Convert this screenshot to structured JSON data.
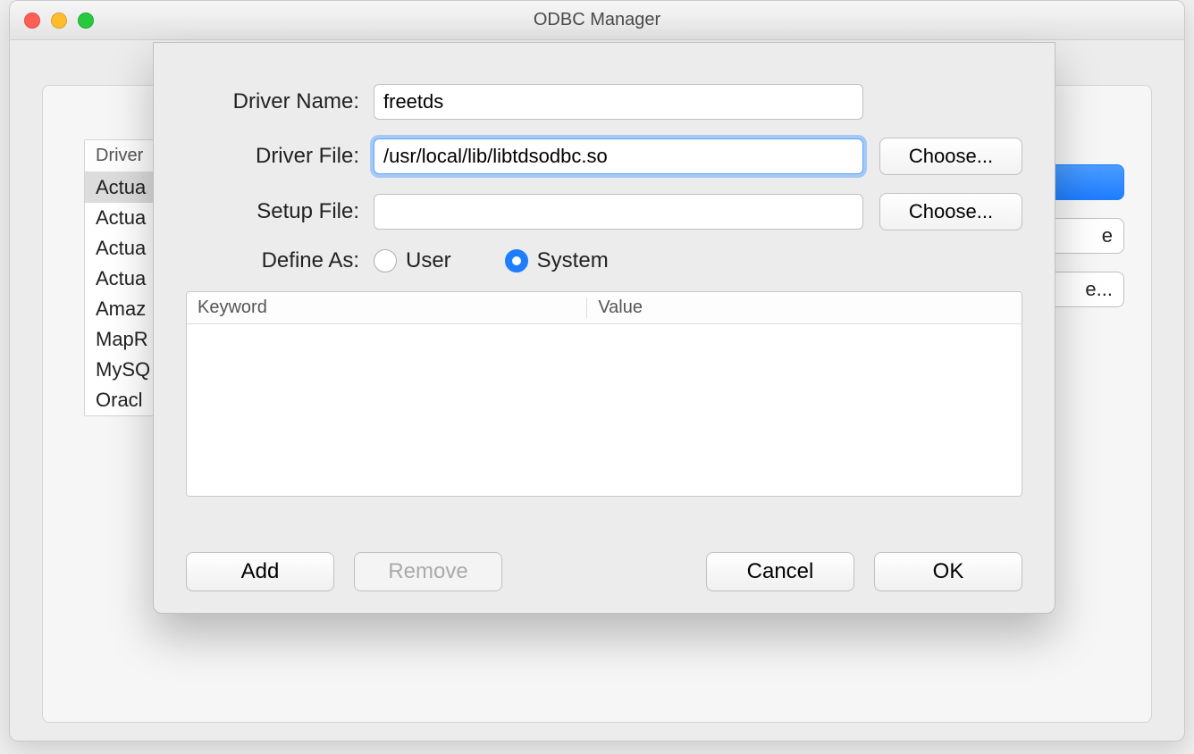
{
  "window": {
    "title": "ODBC Manager"
  },
  "background": {
    "list_header": "Driver",
    "list_items": [
      "Actua",
      "Actua",
      "Actua",
      "Actua",
      "Amaz",
      "MapR",
      "MySQ",
      "Oracl"
    ],
    "side_buttons": [
      "",
      "e",
      "e..."
    ]
  },
  "dialog": {
    "labels": {
      "driver_name": "Driver Name:",
      "driver_file": "Driver File:",
      "setup_file": "Setup File:",
      "define_as": "Define As:"
    },
    "fields": {
      "driver_name": "freetds",
      "driver_file": "/usr/local/lib/libtdsodbc.so",
      "setup_file": ""
    },
    "choose_label": "Choose...",
    "define_options": {
      "user": "User",
      "system": "System"
    },
    "define_selected": "system",
    "kv_headers": {
      "keyword": "Keyword",
      "value": "Value"
    },
    "kv_rows": [],
    "buttons": {
      "add": "Add",
      "remove": "Remove",
      "cancel": "Cancel",
      "ok": "OK"
    }
  }
}
